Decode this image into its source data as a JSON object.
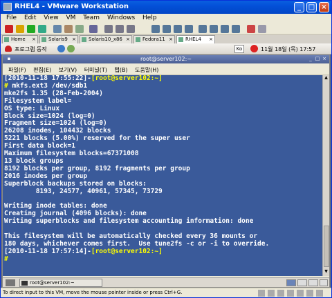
{
  "window": {
    "title": "RHEL4 - VMware Workstation"
  },
  "menu": [
    "File",
    "Edit",
    "View",
    "VM",
    "Team",
    "Windows",
    "Help"
  ],
  "tabs": [
    {
      "label": "Home"
    },
    {
      "label": "Solaris9"
    },
    {
      "label": "Solaris10_x86"
    },
    {
      "label": "Fedora11"
    },
    {
      "label": "RHEL4",
      "active": true
    }
  ],
  "guest_panel": {
    "apps_label": "프로그램  동작",
    "ime_label": "Ko",
    "clock": "11월 18일 (목)  17:57"
  },
  "terminal": {
    "title": "root@server102:~",
    "menu": [
      "파일(F)",
      "편집(E)",
      "보기(V)",
      "터미널(T)",
      "탭(B)",
      "도움말(H)"
    ],
    "lines": [
      {
        "prefix": "[2010-11-18 17:55:22]-",
        "prompt": "[root@server102:~]",
        "text": ""
      },
      {
        "prefix": "",
        "prompt": "#",
        "text": " mkfs.ext3 /dev/sdb1"
      },
      {
        "text": "mke2fs 1.35 (28-Feb-2004)"
      },
      {
        "text": "Filesystem label="
      },
      {
        "text": "OS type: Linux"
      },
      {
        "text": "Block size=1024 (log=0)"
      },
      {
        "text": "Fragment size=1024 (log=0)"
      },
      {
        "text": "26208 inodes, 104432 blocks"
      },
      {
        "text": "5221 blocks (5.00%) reserved for the super user"
      },
      {
        "text": "First data block=1"
      },
      {
        "text": "Maximum filesystem blocks=67371008"
      },
      {
        "text": "13 block groups"
      },
      {
        "text": "8192 blocks per group, 8192 fragments per group"
      },
      {
        "text": "2016 inodes per group"
      },
      {
        "text": "Superblock backups stored on blocks:"
      },
      {
        "text": "        8193, 24577, 40961, 57345, 73729"
      },
      {
        "text": ""
      },
      {
        "text": "Writing inode tables: done"
      },
      {
        "text": "Creating journal (4096 blocks): done"
      },
      {
        "text": "Writing superblocks and filesystem accounting information: done"
      },
      {
        "text": ""
      },
      {
        "text": "This filesystem will be automatically checked every 36 mounts or"
      },
      {
        "text": "180 days, whichever comes first.  Use tune2fs -c or -i to override."
      },
      {
        "prefix": "[2010-11-18 17:57:14]-",
        "prompt": "[root@server102:~]",
        "text": ""
      },
      {
        "prefix": "",
        "prompt": "#",
        "text": ""
      }
    ]
  },
  "taskbar": {
    "item": "root@server102:~"
  },
  "statusbar": {
    "text": "To direct input to this VM, move the mouse pointer inside or press Ctrl+G."
  },
  "colors": {
    "terminal_bg": "#3a5a9a",
    "terminal_fg": "#ffffff",
    "prompt": "#ffff00"
  }
}
